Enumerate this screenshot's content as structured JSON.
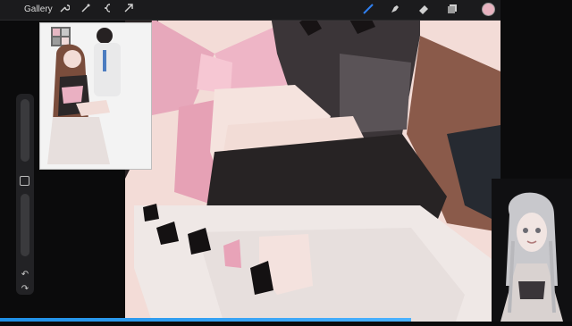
{
  "app": {
    "gallery_label": "Gallery",
    "left_tools": [
      "wrench-icon",
      "magic-wand-icon",
      "selection-icon",
      "transform-arrow-icon"
    ],
    "right_tools": [
      "brush-icon",
      "smudge-icon",
      "eraser-icon",
      "layers-icon"
    ],
    "current_color": "#e8b3c0"
  },
  "reference_window": {
    "title": ""
  },
  "colors": {
    "accent_blue": "#2f7ff0",
    "ribbon_pink": "#e9a9be",
    "skin": "#f1d9d5",
    "dress_white": "#efe8e6"
  }
}
